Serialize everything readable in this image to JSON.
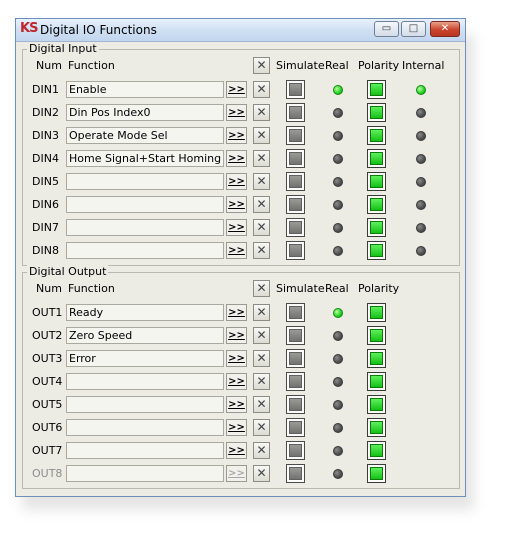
{
  "window": {
    "logo": "KS",
    "title": "Digital IO Functions",
    "minimize": "▭",
    "maximize": "□",
    "close": "✕"
  },
  "headers": {
    "num": "Num",
    "function": "Function",
    "simulate": "Simulate",
    "real": "Real",
    "polarity": "Polarity",
    "internal": "Internal"
  },
  "controls": {
    "arrow_label": ">>",
    "clear_label": "✕"
  },
  "digital_input": {
    "legend": "Digital Input",
    "rows": [
      {
        "num": "DIN1",
        "function": "Enable",
        "real": "on",
        "polarity": "active",
        "internal": "on"
      },
      {
        "num": "DIN2",
        "function": "Din Pos Index0",
        "real": "off",
        "polarity": "active",
        "internal": "off"
      },
      {
        "num": "DIN3",
        "function": "Operate Mode Sel",
        "real": "off",
        "polarity": "active",
        "internal": "off"
      },
      {
        "num": "DIN4",
        "function": "Home Signal+Start Homing",
        "real": "off",
        "polarity": "active",
        "internal": "off"
      },
      {
        "num": "DIN5",
        "function": "",
        "real": "off",
        "polarity": "active",
        "internal": "off"
      },
      {
        "num": "DIN6",
        "function": "",
        "real": "off",
        "polarity": "active",
        "internal": "off"
      },
      {
        "num": "DIN7",
        "function": "",
        "real": "off",
        "polarity": "active",
        "internal": "off"
      },
      {
        "num": "DIN8",
        "function": "",
        "real": "off",
        "polarity": "active",
        "internal": "off"
      }
    ]
  },
  "digital_output": {
    "legend": "Digital Output",
    "rows": [
      {
        "num": "OUT1",
        "function": "Ready",
        "real": "on",
        "polarity": "active",
        "enabled": true
      },
      {
        "num": "OUT2",
        "function": "Zero Speed",
        "real": "off",
        "polarity": "active",
        "enabled": true
      },
      {
        "num": "OUT3",
        "function": "Error",
        "real": "off",
        "polarity": "active",
        "enabled": true
      },
      {
        "num": "OUT4",
        "function": "",
        "real": "off",
        "polarity": "active",
        "enabled": true
      },
      {
        "num": "OUT5",
        "function": "",
        "real": "off",
        "polarity": "active",
        "enabled": true
      },
      {
        "num": "OUT6",
        "function": "",
        "real": "off",
        "polarity": "active",
        "enabled": true
      },
      {
        "num": "OUT7",
        "function": "",
        "real": "off",
        "polarity": "active",
        "enabled": true
      },
      {
        "num": "OUT8",
        "function": "",
        "real": "off",
        "polarity": "active",
        "enabled": false
      }
    ]
  },
  "colors": {
    "led_on": "#22d022",
    "led_off": "#4a4a4a",
    "polarity_fill": "#16c016",
    "window_bg": "#ecebe4"
  }
}
